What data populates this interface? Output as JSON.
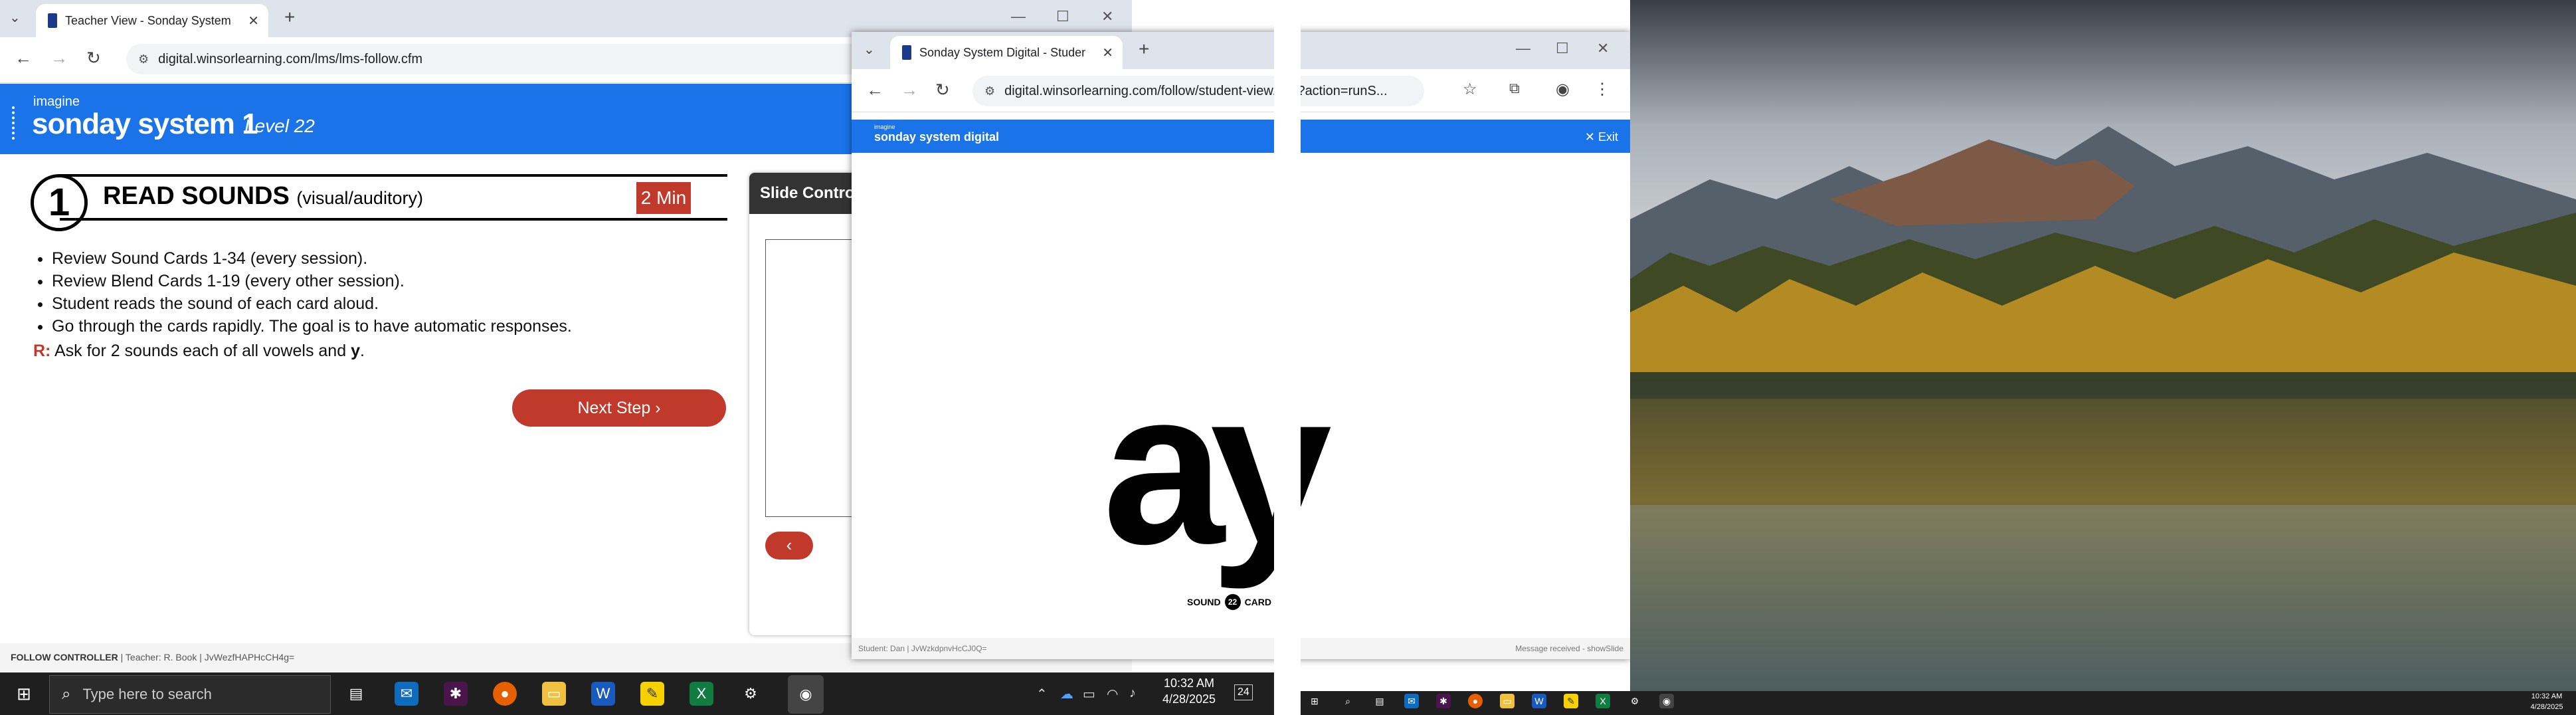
{
  "teacher_window": {
    "tab_title": "Teacher View - Sonday System",
    "url": "digital.winsorlearning.com/lms/lms-follow.cfm",
    "brand": {
      "imagine": "imagine",
      "name": "sonday system 1",
      "level": "Level 22"
    },
    "step": {
      "number": "1",
      "title": "READ SOUNDS",
      "subtitle": "(visual/auditory)",
      "duration": "2 Min"
    },
    "bullets": [
      "Review Sound Cards 1-34 (every session).",
      "Review Blend Cards 1-19 (every other session).",
      "Student reads the sound of each card aloud.",
      "Go through the cards rapidly. The goal is to have automatic responses."
    ],
    "r_note": {
      "label": "R:",
      "text": "Ask for 2 sounds each of all vowels and ",
      "emph": "y",
      "end": "."
    },
    "next_button": "Next Step ›",
    "slide_controller": {
      "title": "Slide Controller",
      "prev": "‹"
    },
    "footer": {
      "label": "FOLLOW CONTROLLER",
      "detail": " | Teacher: R. Book | JvWezfHAPHcCH4g="
    }
  },
  "student_window": {
    "tab_title": "Sonday System Digital - Student",
    "url": "digital.winsorlearning.com/follow/student-view.cfm?action=runS...",
    "brand_small": "imagine",
    "brand": "sonday system digital",
    "exit": "✕ Exit",
    "card_text": "ay",
    "sound_card": {
      "pre": "SOUND",
      "num": "22",
      "post": "CARD"
    },
    "footer": {
      "student": "Student: Dan | JvWzkdpnvHcCJ0Q=",
      "status": "Message received - showSlide"
    }
  },
  "taskbar_main": {
    "search_placeholder": "Type here to search",
    "time": "10:32 AM",
    "date": "4/28/2025",
    "notifications": "24"
  },
  "taskbar_secondary": {
    "time": "10:32 AM",
    "date": "4/28/2025"
  },
  "colors": {
    "brand_blue": "#1a73e8",
    "accent_red": "#c0392b",
    "taskbar": "#1f1f1f"
  }
}
